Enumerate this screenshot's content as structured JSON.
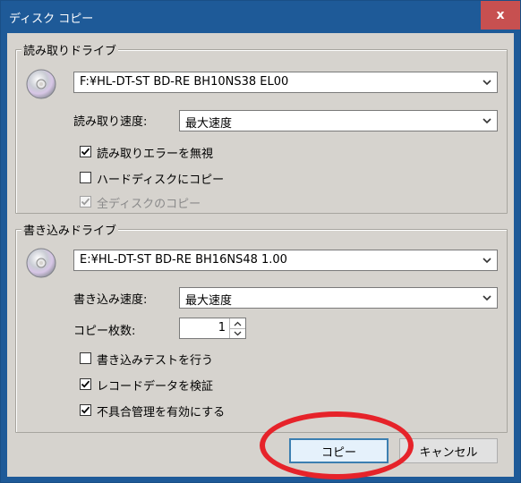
{
  "window": {
    "title": "ディスク コピー",
    "close_label": "x"
  },
  "read_group": {
    "title": "読み取りドライブ",
    "drive": "F:¥HL-DT-ST BD-RE BH10NS38 EL00",
    "speed_label": "読み取り速度:",
    "speed_value": "最大速度",
    "ignore_errors": {
      "label": "読み取りエラーを無視",
      "checked": true
    },
    "copy_to_hdd": {
      "label": "ハードディスクにコピー",
      "checked": false
    },
    "full_disc_copy": {
      "label": "全ディスクのコピー",
      "checked": true,
      "disabled": true
    }
  },
  "write_group": {
    "title": "書き込みドライブ",
    "drive": "E:¥HL-DT-ST BD-RE BH16NS48 1.00",
    "speed_label": "書き込み速度:",
    "speed_value": "最大速度",
    "copies_label": "コピー枚数:",
    "copies_value": "1",
    "test_write": {
      "label": "書き込みテストを行う",
      "checked": false
    },
    "verify": {
      "label": "レコードデータを検証",
      "checked": true
    },
    "burn_proof": {
      "label": "不具合管理を有効にする",
      "checked": true
    }
  },
  "buttons": {
    "copy": "コピー",
    "cancel": "キャンセル"
  },
  "colors": {
    "titlebar": "#1e5a98",
    "close": "#c75050",
    "dialog": "#d6d3ce",
    "annotation": "#e6232a"
  }
}
